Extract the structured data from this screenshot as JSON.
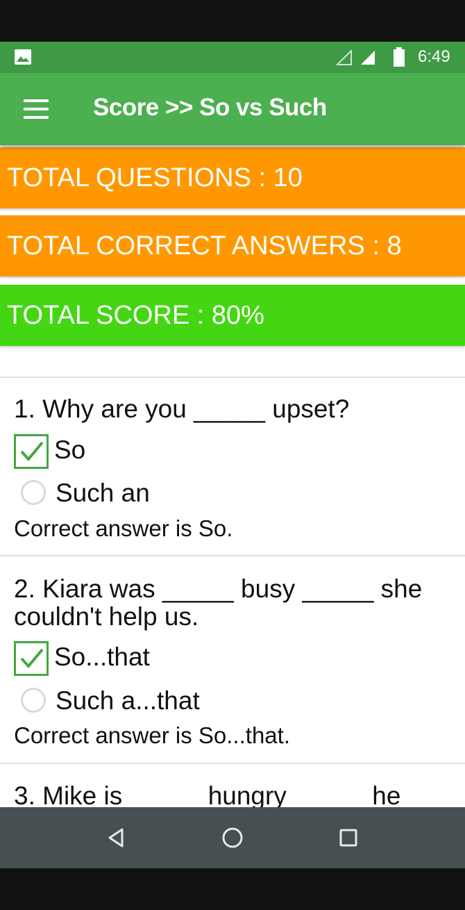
{
  "status_bar": {
    "time": "6:49",
    "icons": [
      "gallery-icon",
      "signal-outline-icon",
      "signal-icon",
      "battery-icon"
    ]
  },
  "toolbar": {
    "title": "Score >> So vs Such",
    "menu_icon": "hamburger-menu-icon"
  },
  "summary": {
    "total_questions": "TOTAL QUESTIONS : 10",
    "total_correct": "TOTAL CORRECT ANSWERS : 8",
    "total_score": "TOTAL SCORE : 80%"
  },
  "questions": [
    {
      "text": "1. Why are you _____ upset?",
      "options": [
        {
          "label": "So",
          "checked": true
        },
        {
          "label": "Such an",
          "checked": false
        }
      ],
      "answer": "Correct answer is So."
    },
    {
      "text": "2. Kiara was _____ busy _____ she couldn't help us.",
      "options": [
        {
          "label": "So...that",
          "checked": true
        },
        {
          "label": "Such a...that",
          "checked": false
        }
      ],
      "answer": "Correct answer is So...that."
    },
    {
      "text": "3. Mike is _____ hungry _____ he"
    }
  ],
  "colors": {
    "status_bar": "#3f9a45",
    "toolbar": "#4caf50",
    "orange_card": "#ff9800",
    "green_card": "#44d613",
    "check_green": "#43a83f",
    "nav_bar": "#464f52"
  },
  "nav_bar": {
    "icons": [
      "back-icon",
      "home-icon",
      "recents-icon"
    ]
  }
}
